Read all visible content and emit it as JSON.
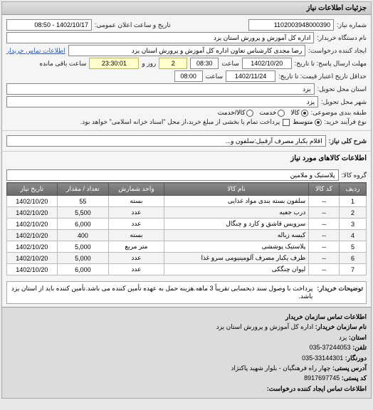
{
  "panel": {
    "title": "جزئیات اطلاعات نیاز"
  },
  "header": {
    "req_no_label": "شماره نیاز:",
    "req_no": "1102003948000390",
    "announce_label": "تاریخ و ساعت اعلان عمومی:",
    "announce_value": "1402/10/17 - 08:50",
    "buyer_label": "نام دستگاه خریدار:",
    "buyer": "اداره کل آموزش و پرورش استان یزد",
    "requester_label": "ایجاد کننده درخواست:",
    "requester": "رضا مجدی کارشناس تعاون اداره کل آموزش و پرورش استان یزد",
    "contact_link": "اطلاعات تماس خریدار",
    "deadline_label": "مهلت ارسال پاسخ: تا تاریخ:",
    "deadline_date": "1402/10/20",
    "time_label": "ساعت",
    "deadline_time": "08:30",
    "remain_day": "2",
    "day_word": "روز و",
    "remain_time": "23:30:01",
    "remain_suffix": "ساعت باقی مانده",
    "validity_label": "حداقل تاریخ اعتبار قیمت: تا تاریخ:",
    "validity_date": "1402/11/24",
    "validity_time": "08:00",
    "province_label": "استان محل تحویل:",
    "province": "یزد",
    "city_label": "شهر محل تحویل:",
    "city": "یزد",
    "budget_label": "طبقه بندی موضوعی:",
    "budget_options": {
      "a": "کالا",
      "b": "خدمت",
      "c": "کالا/خدمت"
    },
    "proc_label": "نوع فرآیند خرید:",
    "proc_options": {
      "a": "متوسط"
    },
    "pay_check_label": "پرداخت تمام یا بخشی از مبلغ خرید،از محل \"اسناد خزانه اسلامی\" خواهد بود."
  },
  "need": {
    "title_label": "شرح کلی نیاز:",
    "title_value": "اقلام یکبار مصرف آزقبیل:سلفون و..."
  },
  "goods": {
    "section_title": "اطلاعات کالاهای مورد نیاز",
    "group_label": "گروه کالا:",
    "group_value": "پلاستیک و ملامین",
    "columns": [
      "ردیف",
      "کد کالا",
      "نام کالا",
      "واحد شمارش",
      "تعداد / مقدار",
      "تاریخ نیاز"
    ],
    "rows": [
      [
        "1",
        "--",
        "سلفون بسته بندی مواد غذایی",
        "بسته",
        "55",
        "1402/10/20"
      ],
      [
        "2",
        "--",
        "درب جعبه",
        "عدد",
        "5,500",
        "1402/10/20"
      ],
      [
        "3",
        "--",
        "سرویس قاشق و کارد و چنگال",
        "عدد",
        "6,000",
        "1402/10/20"
      ],
      [
        "4",
        "--",
        "کیسه زباله",
        "بسته",
        "400",
        "1402/10/20"
      ],
      [
        "5",
        "--",
        "پلاستیک پوششی",
        "متر مربع",
        "5,000",
        "1402/10/20"
      ],
      [
        "6",
        "--",
        "ظرف یکبار مصرف آلومینیومی سرو غذا",
        "عدد",
        "5,000",
        "1402/10/20"
      ],
      [
        "7",
        "--",
        "لیوان چنگکی",
        "عدد",
        "6,000",
        "1402/10/20"
      ]
    ]
  },
  "desc": {
    "label": "توضیحات خریدار:",
    "text": "پرداخت با وصول سند ذیحسابی تقریباً 3 ماهه.هزینه حمل به عهده تأمین کننده می باشد.تأمین کننده باید از استان یزد باشد."
  },
  "contact": {
    "title": "اطلاعات تماس سازمان خریدار",
    "org_label": "نام سازمان خریدار:",
    "org": "اداره کل آموزش و پرورش استان یزد",
    "province_label": "استان:",
    "province": "یزد",
    "phone_label": "تلفن:",
    "phone": "37244053-035",
    "fax_label": "دورنگار:",
    "fax": "33144301-035",
    "addr_label": "آدرس پستی:",
    "addr": "چهار راه فرهنگیان - بلوار شهید پاکنژاد",
    "post_label": "کد پستی:",
    "post": "8917697745",
    "req_contact_label": "اطلاعات تماس ایجاد کننده درخواست:"
  }
}
